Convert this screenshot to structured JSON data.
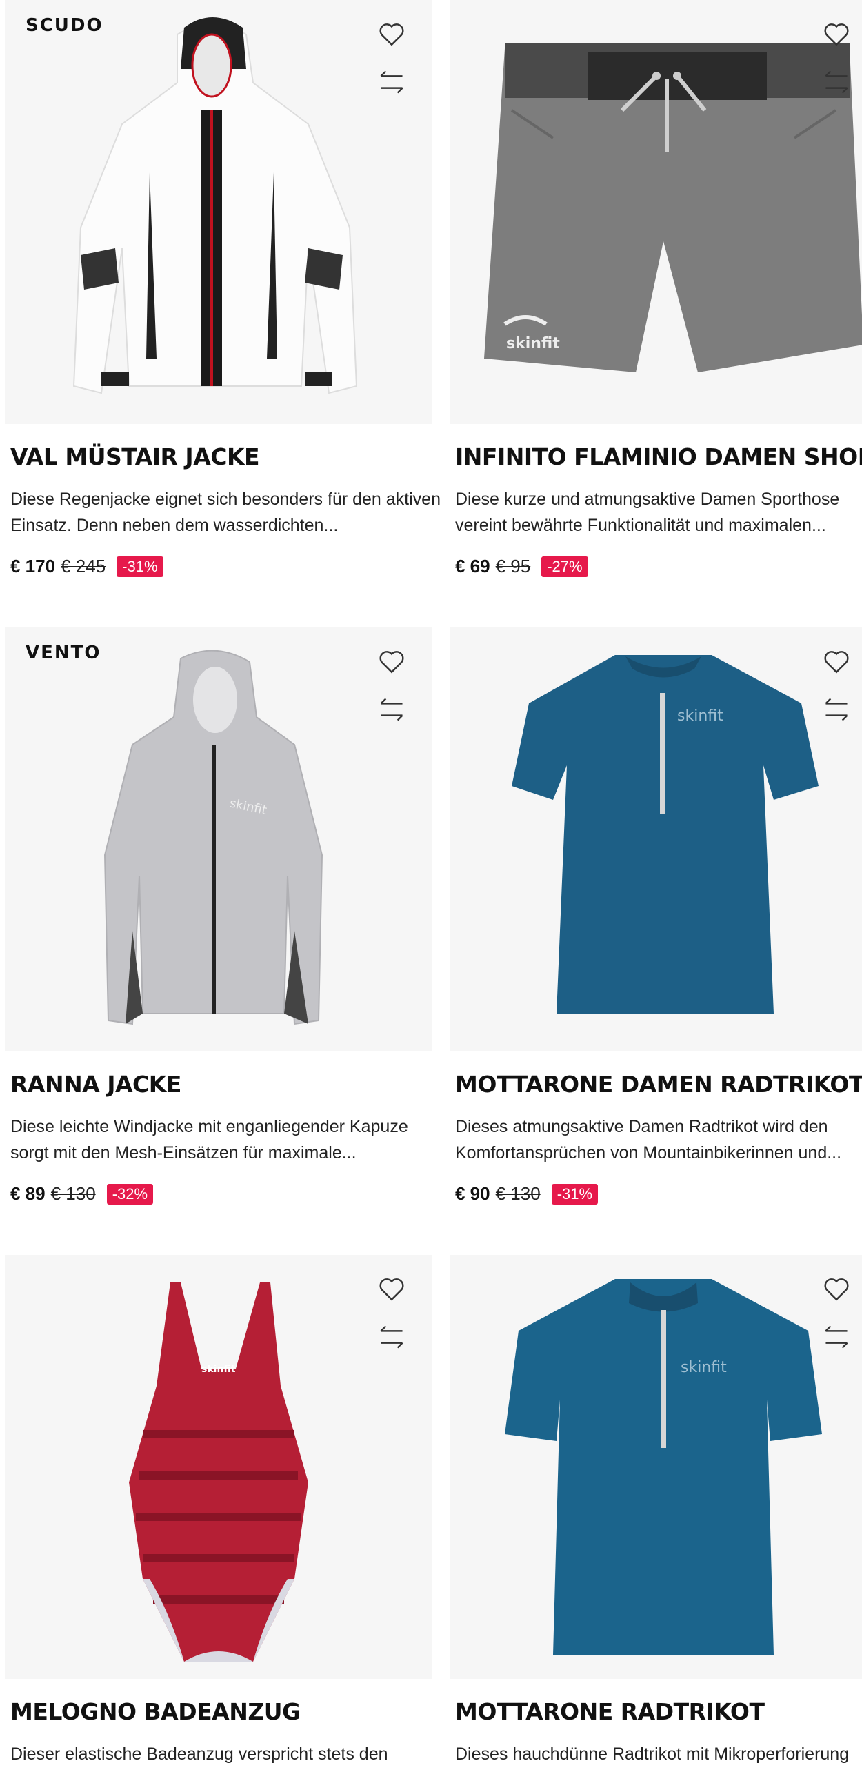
{
  "products": [
    {
      "brand": "SCUDO",
      "title": "VAL MÜSTAIR JACKE",
      "desc_line1": "Diese Regenjacke eignet sich besonders für den aktiven",
      "desc_line2": "Einsatz. Denn neben dem wasserdichten...",
      "price": "€ 170",
      "old_price": "€ 245",
      "discount": "-31%",
      "image_icon": "white-rain-jacket"
    },
    {
      "brand": "",
      "title": "INFINITO FLAMINIO DAMEN SHORTS",
      "desc_line1": "Diese kurze und atmungsaktive Damen Sporthose",
      "desc_line2": "vereint bewährte Funktionalität und maximalen...",
      "price": "€ 69",
      "old_price": "€ 95",
      "discount": "-27%",
      "image_icon": "grey-shorts"
    },
    {
      "brand": "VENTO",
      "title": "RANNA JACKE",
      "desc_line1": "Diese leichte Windjacke mit enganliegender Kapuze",
      "desc_line2": "sorgt mit den Mesh-Einsätzen für maximale...",
      "price": "€ 89",
      "old_price": "€ 130",
      "discount": "-32%",
      "image_icon": "grey-wind-jacket"
    },
    {
      "brand": "",
      "title": "MOTTARONE DAMEN RADTRIKOT",
      "desc_line1": "Dieses atmungsaktive Damen Radtrikot wird den",
      "desc_line2": "Komfortansprüchen von Mountainbikerinnen und...",
      "price": "€ 90",
      "old_price": "€ 130",
      "discount": "-31%",
      "image_icon": "blue-cycling-jersey-women"
    },
    {
      "brand": "",
      "title": "MELOGNO BADEANZUG",
      "desc_line1": "Dieser elastische Badeanzug verspricht stets den",
      "desc_line2": "",
      "price": "",
      "old_price": "",
      "discount": "",
      "image_icon": "red-swimsuit"
    },
    {
      "brand": "",
      "title": "MOTTARONE RADTRIKOT",
      "desc_line1": "Dieses hauchdünne Radtrikot mit Mikroperforierung",
      "desc_line2": "",
      "price": "",
      "old_price": "",
      "discount": "",
      "image_icon": "blue-cycling-jersey"
    }
  ],
  "icons": {
    "wishlist": "heart-icon",
    "compare": "compare-arrows-icon"
  },
  "colors": {
    "sale_badge": "#e6194b",
    "image_bg": "#f6f6f6"
  }
}
